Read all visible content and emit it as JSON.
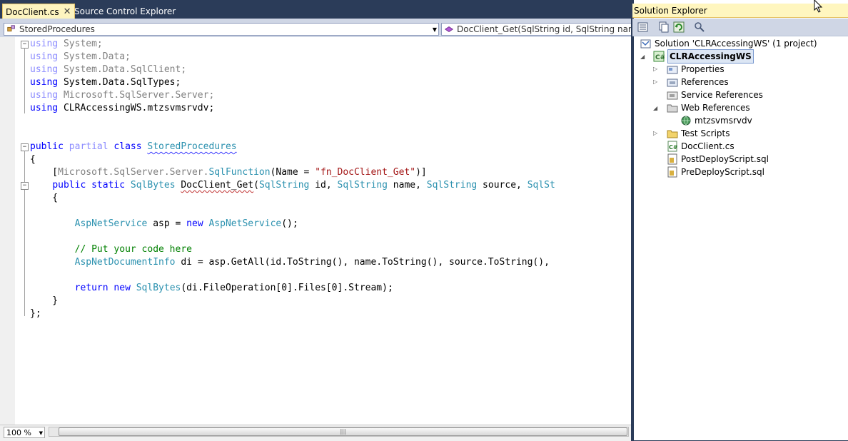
{
  "editor": {
    "tabs": [
      {
        "label": "DocClient.cs",
        "close": "✕"
      },
      {
        "label": "Source Control Explorer"
      }
    ],
    "type_combo": "StoredProcedures",
    "member_combo": "DocClient_Get(SqlString id, SqlString name, Sq",
    "zoom": "100 %",
    "code": {
      "l1a": "using",
      "l1b": " System;",
      "l2a": "using",
      "l2b": " System.Data;",
      "l3a": "using",
      "l3b": " System.Data.SqlClient;",
      "l4a": "using",
      "l4b": " System.Data.SqlTypes;",
      "l5a": "using",
      "l5b": " Microsoft.SqlServer.Server;",
      "l6a": "using",
      "l6b": " CLRAccessingWS.mtzsvmsrvdv;",
      "l7a": "public",
      "l7b": "partial",
      "l7c": "class",
      "l7d": "StoredProcedures",
      "l8": "{",
      "l9a": "    [",
      "l9b": "Microsoft.SqlServer.Server.",
      "l9c": "SqlFunction",
      "l9d": "(Name = ",
      "l9e": "\"fn_DocClient_Get\"",
      "l9f": ")]",
      "l10a": "public",
      "l10b": "static",
      "l10c": "SqlBytes",
      "l10d": "DocClient_Get",
      "l10e": "(",
      "l10f": "SqlString",
      "l10g": " id, ",
      "l10h": "SqlString",
      "l10i": " name, ",
      "l10j": "SqlString",
      "l10k": " source, ",
      "l10l": "SqlSt",
      "l11": "    {",
      "l12a": "AspNetService",
      "l12b": " asp = ",
      "l12c": "new",
      "l12d": "AspNetService",
      "l12e": "();",
      "l13": "// Put your code here",
      "l14a": "AspNetDocumentInfo",
      "l14b": " di = asp.GetAll(id.ToString(), name.ToString(), source.ToString(),",
      "l15a": "return",
      "l15b": "new",
      "l15c": "SqlBytes",
      "l15d": "(di.FileOperation[0].Files[0].Stream);",
      "l16": "    }",
      "l17": "};"
    }
  },
  "solution_explorer": {
    "title": "Solution Explorer",
    "solution": "Solution 'CLRAccessingWS' (1 project)",
    "project": "CLRAccessingWS",
    "items": [
      {
        "label": "Properties"
      },
      {
        "label": "References"
      },
      {
        "label": "Service References"
      },
      {
        "label": "Web References"
      },
      {
        "label": "mtzsvmsrvdv"
      },
      {
        "label": "Test Scripts"
      },
      {
        "label": "DocClient.cs"
      },
      {
        "label": "PostDeployScript.sql"
      },
      {
        "label": "PreDeployScript.sql"
      }
    ]
  },
  "colors": {
    "chrome": "#2b3c59",
    "active_tab": "#fdf4bf",
    "keyword": "#0000ff",
    "type": "#2b91af",
    "string": "#a31515",
    "comment": "#008000"
  }
}
